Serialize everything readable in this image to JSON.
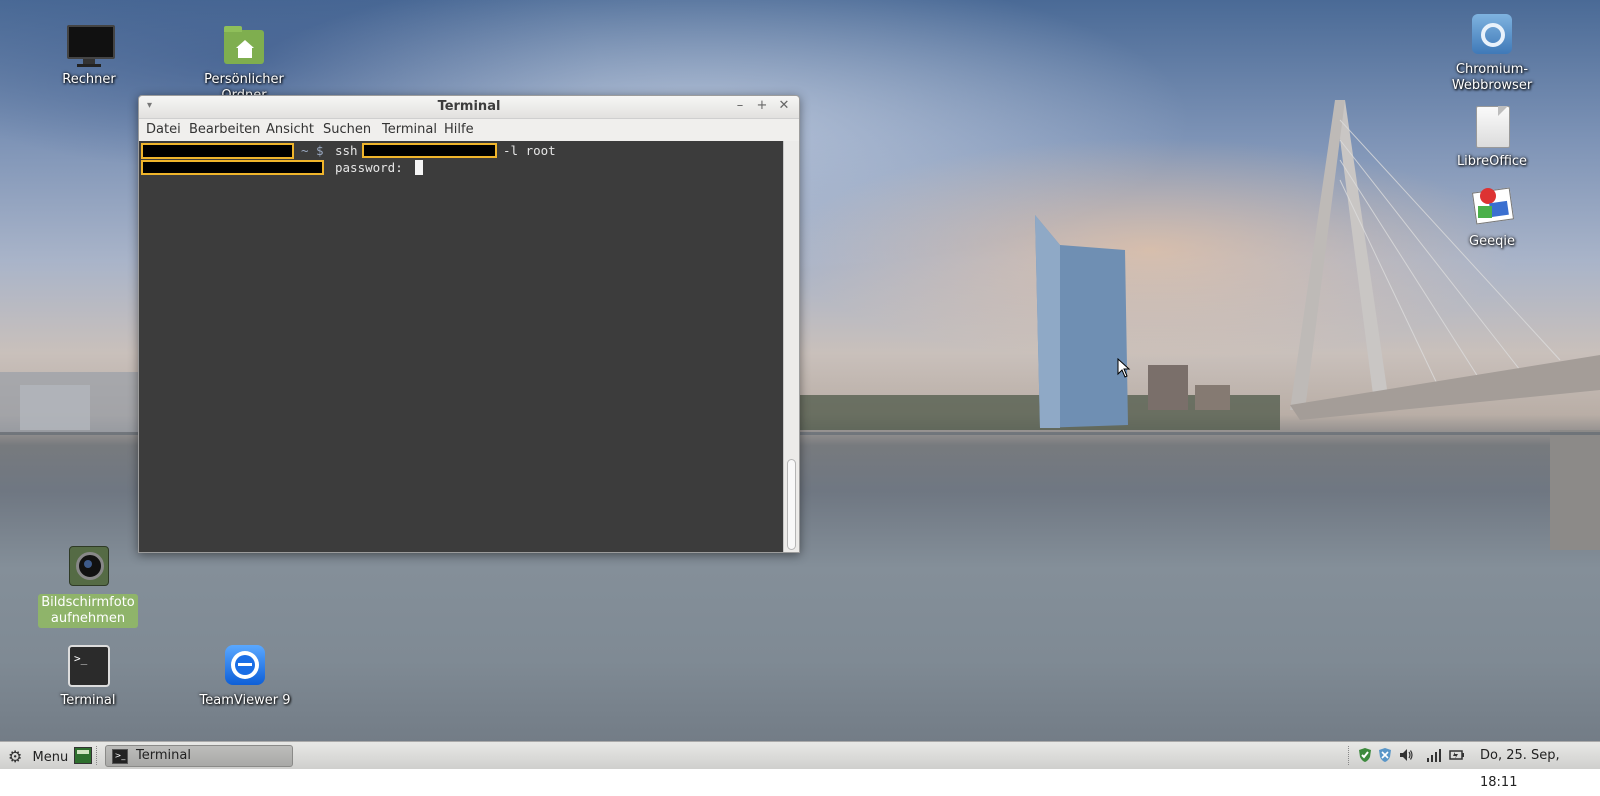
{
  "desktop": {
    "icons": {
      "computer": "Rechner",
      "home_folder": "Persönlicher Ordner",
      "chromium_line1": "Chromium-",
      "chromium_line2": "Webbrowser",
      "libreoffice": "LibreOffice",
      "geeqie": "Geeqie",
      "screenshot_line1": "Bildschirmfoto",
      "screenshot_line2": "aufnehmen",
      "terminal": "Terminal",
      "teamviewer": "TeamViewer 9"
    }
  },
  "window": {
    "title": "Terminal",
    "controls": {
      "menu": "▾",
      "minimize": "–",
      "maximize": "+",
      "close": "✕"
    },
    "menu": [
      "Datei",
      "Bearbeiten",
      "Ansicht",
      "Suchen",
      "Terminal",
      "Hilfe"
    ],
    "terminal": {
      "prompt_suffix": "~ $",
      "command": "ssh",
      "command_args": "-l root",
      "password_prompt": "password:"
    }
  },
  "taskbar": {
    "menu_label": "Menu",
    "task_label": "Terminal",
    "clock": "Do, 25. Sep, 18:11"
  },
  "colors": {
    "terminal_bg": "#3c3c3c",
    "redaction_border": "#f0b52b",
    "selected_icon_bg": "#8fb46a"
  }
}
